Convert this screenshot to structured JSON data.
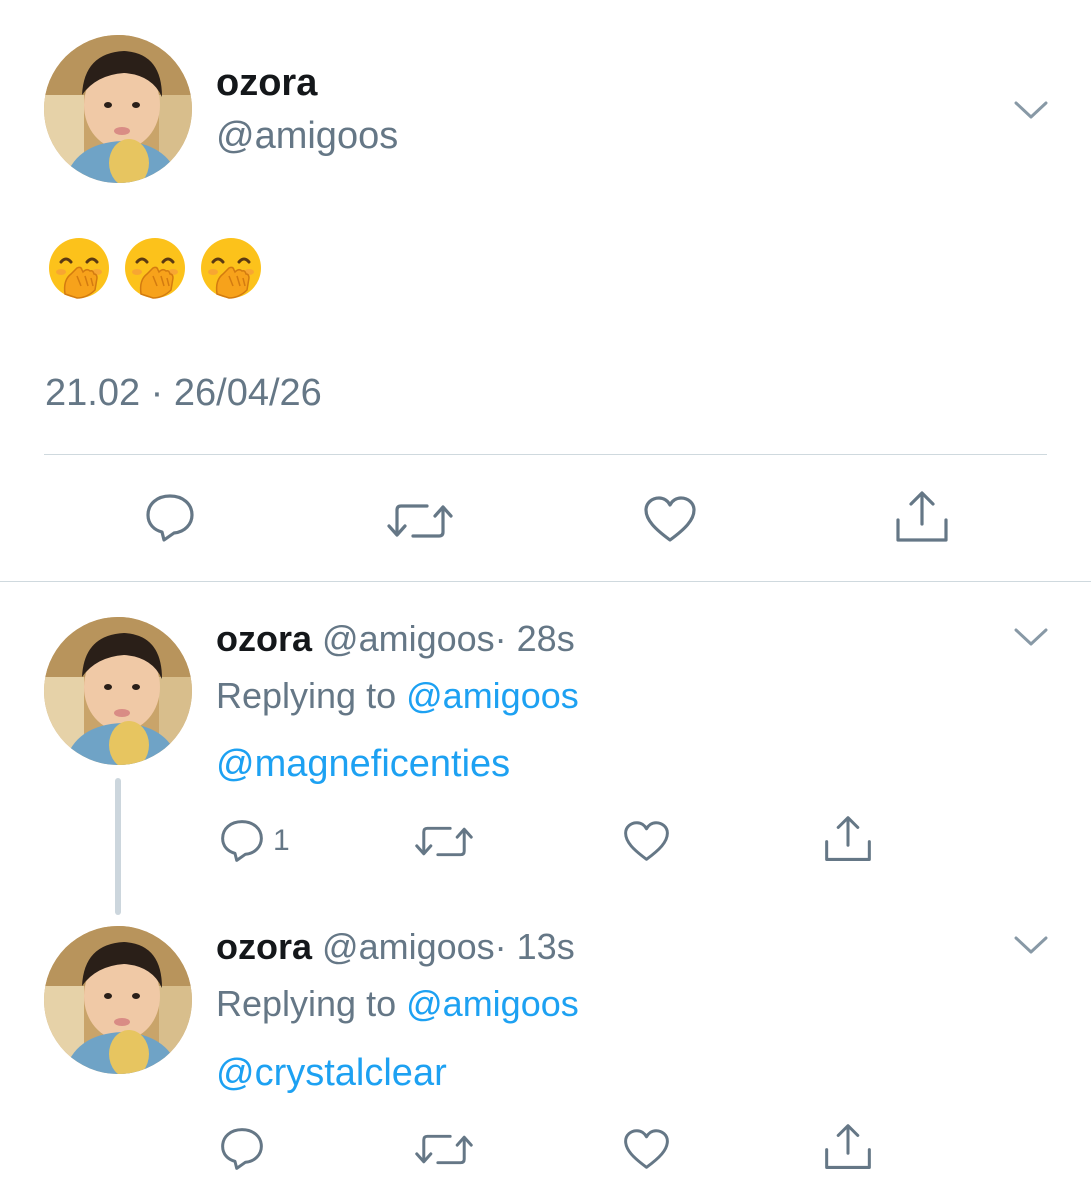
{
  "colors": {
    "text": "#14171a",
    "secondary": "#657786",
    "link": "#1da1f2",
    "divider": "#cfd9de",
    "thread_line": "#ccd6dd"
  },
  "main_tweet": {
    "name": "ozora",
    "handle": "@amigoos",
    "emojis": [
      "hand-over-mouth-emoji",
      "hand-over-mouth-emoji",
      "hand-over-mouth-emoji"
    ],
    "timestamp": "21.02 · 26/04/26",
    "actions": {
      "reply_icon": "reply-icon",
      "retweet_icon": "retweet-icon",
      "like_icon": "heart-icon",
      "share_icon": "share-icon"
    }
  },
  "replies": [
    {
      "name": "ozora",
      "handle": "@amigoos",
      "time": "· 28s",
      "replying_prefix": "Replying to",
      "replying_handle": "@amigoos",
      "mention": "@magneficenties",
      "reply_count": "1"
    },
    {
      "name": "ozora",
      "handle": "@amigoos",
      "time": "· 13s",
      "replying_prefix": "Replying to",
      "replying_handle": "@amigoos",
      "mention": "@crystalclear",
      "reply_count": ""
    }
  ]
}
